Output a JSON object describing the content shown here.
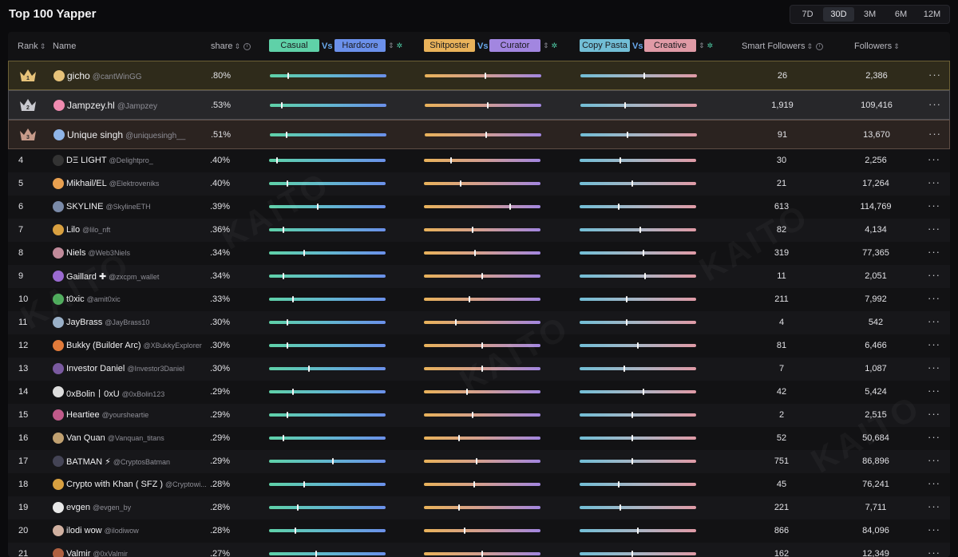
{
  "page": {
    "title": "Top 100 Yapper"
  },
  "periods": [
    {
      "label": "7D",
      "active": false
    },
    {
      "label": "30D",
      "active": true
    },
    {
      "label": "3M",
      "active": false
    },
    {
      "label": "6M",
      "active": false
    },
    {
      "label": "12M",
      "active": false
    }
  ],
  "header": {
    "rank": "Rank",
    "name": "Name",
    "share": "share",
    "casual": "Casual",
    "vs": "Vs",
    "hardcore": "Hardcore",
    "shitposter": "Shitposter",
    "curator": "Curator",
    "copy_pasta": "Copy Pasta",
    "creative": "Creative",
    "smart_followers": "Smart Followers",
    "followers": "Followers",
    "sort_icon": "sort-icon",
    "info_icon": "info-icon",
    "settings_icon": "gear-icon"
  },
  "colors": {
    "casual": "#5fd1a8",
    "hardcore": "#6b90ea",
    "shitposter": "#e9b25a",
    "curator": "#a286e0",
    "copy_pasta": "#72bed6",
    "creative": "#e09aa6"
  },
  "watermark": "KAITO",
  "rows": [
    {
      "rank": "1",
      "name": "gicho",
      "handle": "@cantWinGG",
      "share": ".80%",
      "t1": 0.15,
      "t2": 0.52,
      "t3": 0.55,
      "smart": "26",
      "followers": "2,386"
    },
    {
      "rank": "2",
      "name": "Jampzey.hl",
      "handle": "@Jampzey",
      "share": ".53%",
      "t1": 0.1,
      "t2": 0.54,
      "t3": 0.38,
      "smart": "1,919",
      "followers": "109,416"
    },
    {
      "rank": "3",
      "name": "Unique singh",
      "handle": "@uniquesingh__",
      "share": ".51%",
      "t1": 0.14,
      "t2": 0.53,
      "t3": 0.4,
      "smart": "91",
      "followers": "13,670"
    },
    {
      "rank": "4",
      "name": "DΞ LIGHT",
      "handle": "@Delightpro_",
      "share": ".40%",
      "t1": 0.06,
      "t2": 0.23,
      "t3": 0.35,
      "smart": "30",
      "followers": "2,256"
    },
    {
      "rank": "5",
      "name": "Mikhail/EL",
      "handle": "@Elektroveniks",
      "share": ".40%",
      "t1": 0.15,
      "t2": 0.31,
      "t3": 0.45,
      "smart": "21",
      "followers": "17,264"
    },
    {
      "rank": "6",
      "name": "SKYLINE",
      "handle": "@SkylineETH",
      "share": ".39%",
      "t1": 0.42,
      "t2": 0.74,
      "t3": 0.33,
      "smart": "613",
      "followers": "114,769"
    },
    {
      "rank": "7",
      "name": "Lilo",
      "handle": "@lilo_nft",
      "share": ".36%",
      "t1": 0.12,
      "t2": 0.42,
      "t3": 0.52,
      "smart": "82",
      "followers": "4,134"
    },
    {
      "rank": "8",
      "name": "Niels",
      "handle": "@Web3Niels",
      "share": ".34%",
      "t1": 0.3,
      "t2": 0.44,
      "t3": 0.55,
      "smart": "319",
      "followers": "77,365"
    },
    {
      "rank": "9",
      "name": "Gaillard ✚",
      "handle": "@zxcpm_wallet",
      "share": ".34%",
      "t1": 0.12,
      "t2": 0.5,
      "t3": 0.56,
      "smart": "11",
      "followers": "2,051"
    },
    {
      "rank": "10",
      "name": "t0xic",
      "handle": "@amit0xic",
      "share": ".33%",
      "t1": 0.2,
      "t2": 0.39,
      "t3": 0.4,
      "smart": "211",
      "followers": "7,992"
    },
    {
      "rank": "11",
      "name": "JayBrass",
      "handle": "@JayBrass10",
      "share": ".30%",
      "t1": 0.15,
      "t2": 0.27,
      "t3": 0.4,
      "smart": "4",
      "followers": "542"
    },
    {
      "rank": "12",
      "name": "Bukky (Builder Arc)",
      "handle": "@XBukkyExplorer",
      "share": ".30%",
      "t1": 0.15,
      "t2": 0.5,
      "t3": 0.5,
      "smart": "81",
      "followers": "6,466"
    },
    {
      "rank": "13",
      "name": "Investor Daniel",
      "handle": "@Investor3Daniel",
      "share": ".30%",
      "t1": 0.34,
      "t2": 0.5,
      "t3": 0.38,
      "smart": "7",
      "followers": "1,087"
    },
    {
      "rank": "14",
      "name": "0xBolin丨0xU",
      "handle": "@0xBolin123",
      "share": ".29%",
      "t1": 0.2,
      "t2": 0.37,
      "t3": 0.55,
      "smart": "42",
      "followers": "5,424"
    },
    {
      "rank": "15",
      "name": "Heartiee",
      "handle": "@yoursheartie",
      "share": ".29%",
      "t1": 0.15,
      "t2": 0.42,
      "t3": 0.45,
      "smart": "2",
      "followers": "2,515"
    },
    {
      "rank": "16",
      "name": "Van Quan",
      "handle": "@Vanquan_titans",
      "share": ".29%",
      "t1": 0.12,
      "t2": 0.3,
      "t3": 0.45,
      "smart": "52",
      "followers": "50,684"
    },
    {
      "rank": "17",
      "name": "BATMAN ⚡",
      "handle": "@CryptosBatman",
      "share": ".29%",
      "t1": 0.55,
      "t2": 0.45,
      "t3": 0.45,
      "smart": "751",
      "followers": "86,896"
    },
    {
      "rank": "18",
      "name": "Crypto with Khan ( SFZ )",
      "handle": "@Cryptowi...",
      "share": ".28%",
      "t1": 0.3,
      "t2": 0.43,
      "t3": 0.33,
      "smart": "45",
      "followers": "76,241"
    },
    {
      "rank": "19",
      "name": "evgen",
      "handle": "@evgen_by",
      "share": ".28%",
      "t1": 0.24,
      "t2": 0.3,
      "t3": 0.35,
      "smart": "221",
      "followers": "7,711"
    },
    {
      "rank": "20",
      "name": "ilodi wow",
      "handle": "@ilodiwow",
      "share": ".28%",
      "t1": 0.22,
      "t2": 0.35,
      "t3": 0.5,
      "smart": "866",
      "followers": "84,096"
    },
    {
      "rank": "21",
      "name": "Valmir",
      "handle": "@0xValmir",
      "share": ".27%",
      "t1": 0.4,
      "t2": 0.5,
      "t3": 0.45,
      "smart": "162",
      "followers": "12,349"
    }
  ]
}
